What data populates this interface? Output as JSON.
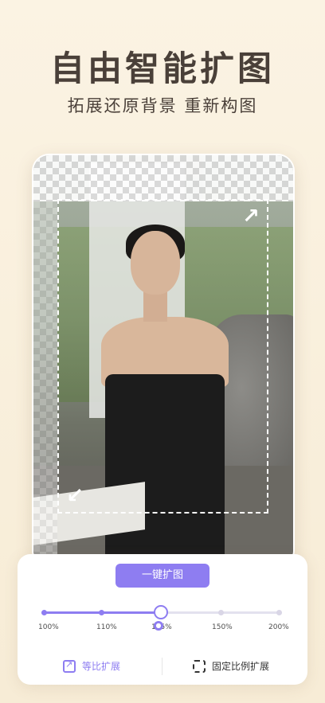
{
  "hero": {
    "title": "自由智能扩图",
    "subtitle": "拓展还原背景 重新构图"
  },
  "editor": {
    "expand_arrow_tr": "↗",
    "expand_arrow_bl": "↙"
  },
  "panel": {
    "one_key_button": "一键扩图",
    "slider": {
      "value_label": "125%",
      "ticks": [
        "100%",
        "110%",
        "125%",
        "150%",
        "200%"
      ],
      "selected_index": 2
    },
    "options": {
      "proportional": "等比扩展",
      "fixed_ratio": "固定比例扩展"
    }
  },
  "colors": {
    "accent": "#8e7df1",
    "title": "#4a4039",
    "background": "#fbf3e3"
  }
}
